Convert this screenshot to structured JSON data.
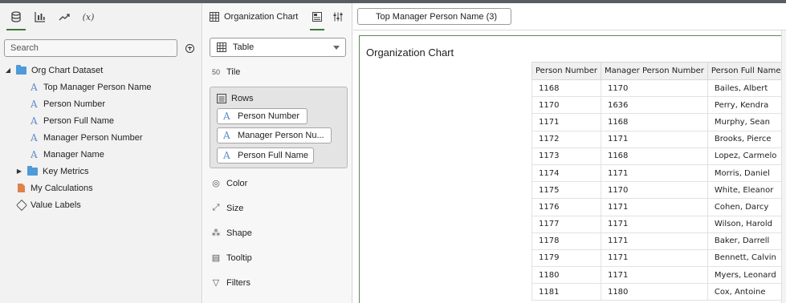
{
  "left_panel": {
    "tabs": [
      {
        "name": "data-icon",
        "active": true
      },
      {
        "name": "visualizations-icon",
        "active": false
      },
      {
        "name": "analytics-icon",
        "active": false
      },
      {
        "name": "expressions-tab",
        "label": "(x)",
        "active": false
      }
    ],
    "search_placeholder": "Search",
    "tree": {
      "dataset": "Org Chart Dataset",
      "columns": [
        "Top Manager Person Name",
        "Person Number",
        "Person Full Name",
        "Manager Person Number",
        "Manager Name"
      ],
      "key_metrics": "Key Metrics",
      "my_calculations": "My Calculations",
      "value_labels": "Value Labels"
    }
  },
  "grammar_panel": {
    "title": "Organization Chart",
    "viz_type": "Table",
    "tile_label": "Tile",
    "rows_label": "Rows",
    "rows_items": [
      "Person Number",
      "Manager Person Nu...",
      "Person Full Name"
    ],
    "color_label": "Color",
    "size_label": "Size",
    "shape_label": "Shape",
    "tooltip_label": "Tooltip",
    "filters_label": "Filters"
  },
  "canvas": {
    "filter_pill": "Top Manager Person Name (3)",
    "viz_title": "Organization Chart",
    "table": {
      "headers": [
        "Person Number",
        "Manager Person Number",
        "Person Full Name"
      ],
      "rows": [
        [
          "1168",
          "1170",
          "Bailes, Albert"
        ],
        [
          "1170",
          "1636",
          "Perry, Kendra"
        ],
        [
          "1171",
          "1168",
          "Murphy, Sean"
        ],
        [
          "1172",
          "1171",
          "Brooks, Pierce"
        ],
        [
          "1173",
          "1168",
          "Lopez, Carmelo"
        ],
        [
          "1174",
          "1171",
          "Morris, Daniel"
        ],
        [
          "1175",
          "1170",
          "White, Eleanor"
        ],
        [
          "1176",
          "1171",
          "Cohen, Darcy"
        ],
        [
          "1177",
          "1171",
          "Wilson, Harold"
        ],
        [
          "1178",
          "1171",
          "Baker, Darrell"
        ],
        [
          "1179",
          "1171",
          "Bennett, Calvin"
        ],
        [
          "1180",
          "1171",
          "Myers, Leonard"
        ],
        [
          "1181",
          "1180",
          "Cox, Antoine"
        ]
      ]
    }
  }
}
